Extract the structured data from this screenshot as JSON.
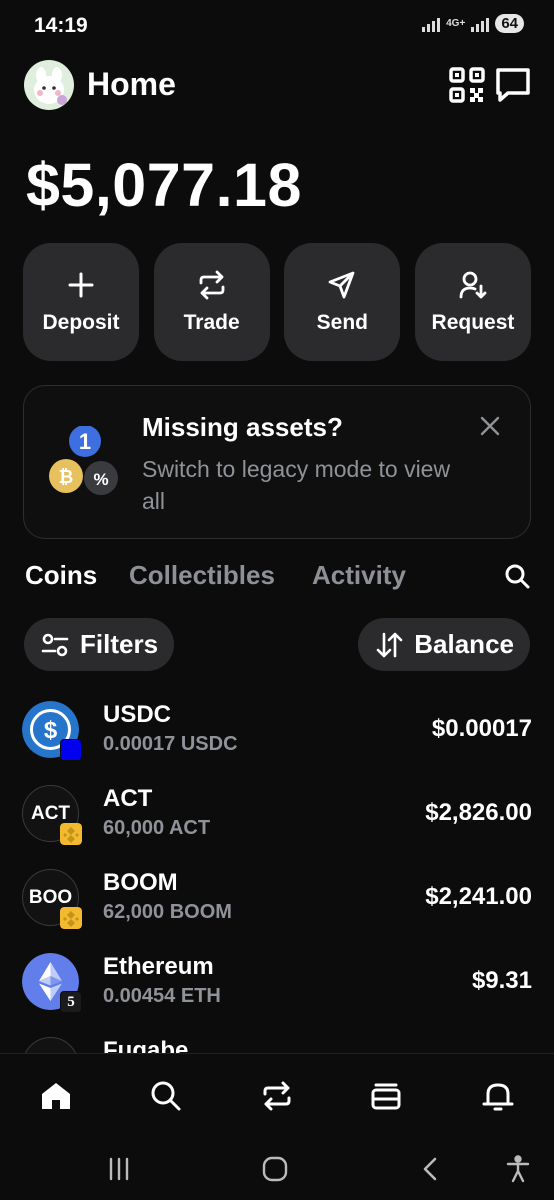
{
  "status_bar": {
    "time": "14:19",
    "network": "4G+",
    "battery": "64"
  },
  "header": {
    "title": "Home"
  },
  "balance": "$5,077.18",
  "actions": [
    {
      "label": "Deposit",
      "icon": "plus-icon"
    },
    {
      "label": "Trade",
      "icon": "swap-icon"
    },
    {
      "label": "Send",
      "icon": "send-icon"
    },
    {
      "label": "Request",
      "icon": "request-icon"
    }
  ],
  "banner": {
    "title": "Missing assets?",
    "text": "Switch to legacy mode to view all",
    "art_labels": {
      "one": "1",
      "percent": "%",
      "bitcoin": "₿"
    }
  },
  "tabs": [
    {
      "label": "Coins",
      "active": true
    },
    {
      "label": "Collectibles",
      "active": false
    },
    {
      "label": "Activity",
      "active": false
    }
  ],
  "filters": {
    "filter_label": "Filters",
    "sort_label": "Balance"
  },
  "coins": [
    {
      "name": "USDC",
      "amount": "0.00017 USDC",
      "value": "$0.00017",
      "icon": "usdc-icon",
      "icon_text": "$"
    },
    {
      "name": "ACT",
      "amount": "60,000 ACT",
      "value": "$2,826.00",
      "icon": "act-icon",
      "icon_text": "ACT"
    },
    {
      "name": "BOOM",
      "amount": "62,000 BOOM",
      "value": "$2,241.00",
      "icon": "boom-icon",
      "icon_text": "BOO"
    },
    {
      "name": "Ethereum",
      "amount": "0.00454 ETH",
      "value": "$9.31",
      "icon": "ethereum-icon",
      "icon_text": "",
      "badge_text": "5"
    },
    {
      "name": "Fugabe",
      "amount": "",
      "value": "",
      "icon": "fugabe-icon",
      "icon_text": ""
    }
  ],
  "colors": {
    "background": "#0c0c0d",
    "card": "#2b2b2e",
    "muted_text": "#8f9398",
    "usdc_blue": "#2775ca",
    "eth_purple": "#627eea",
    "bnb_yellow": "#f3ba2f"
  }
}
